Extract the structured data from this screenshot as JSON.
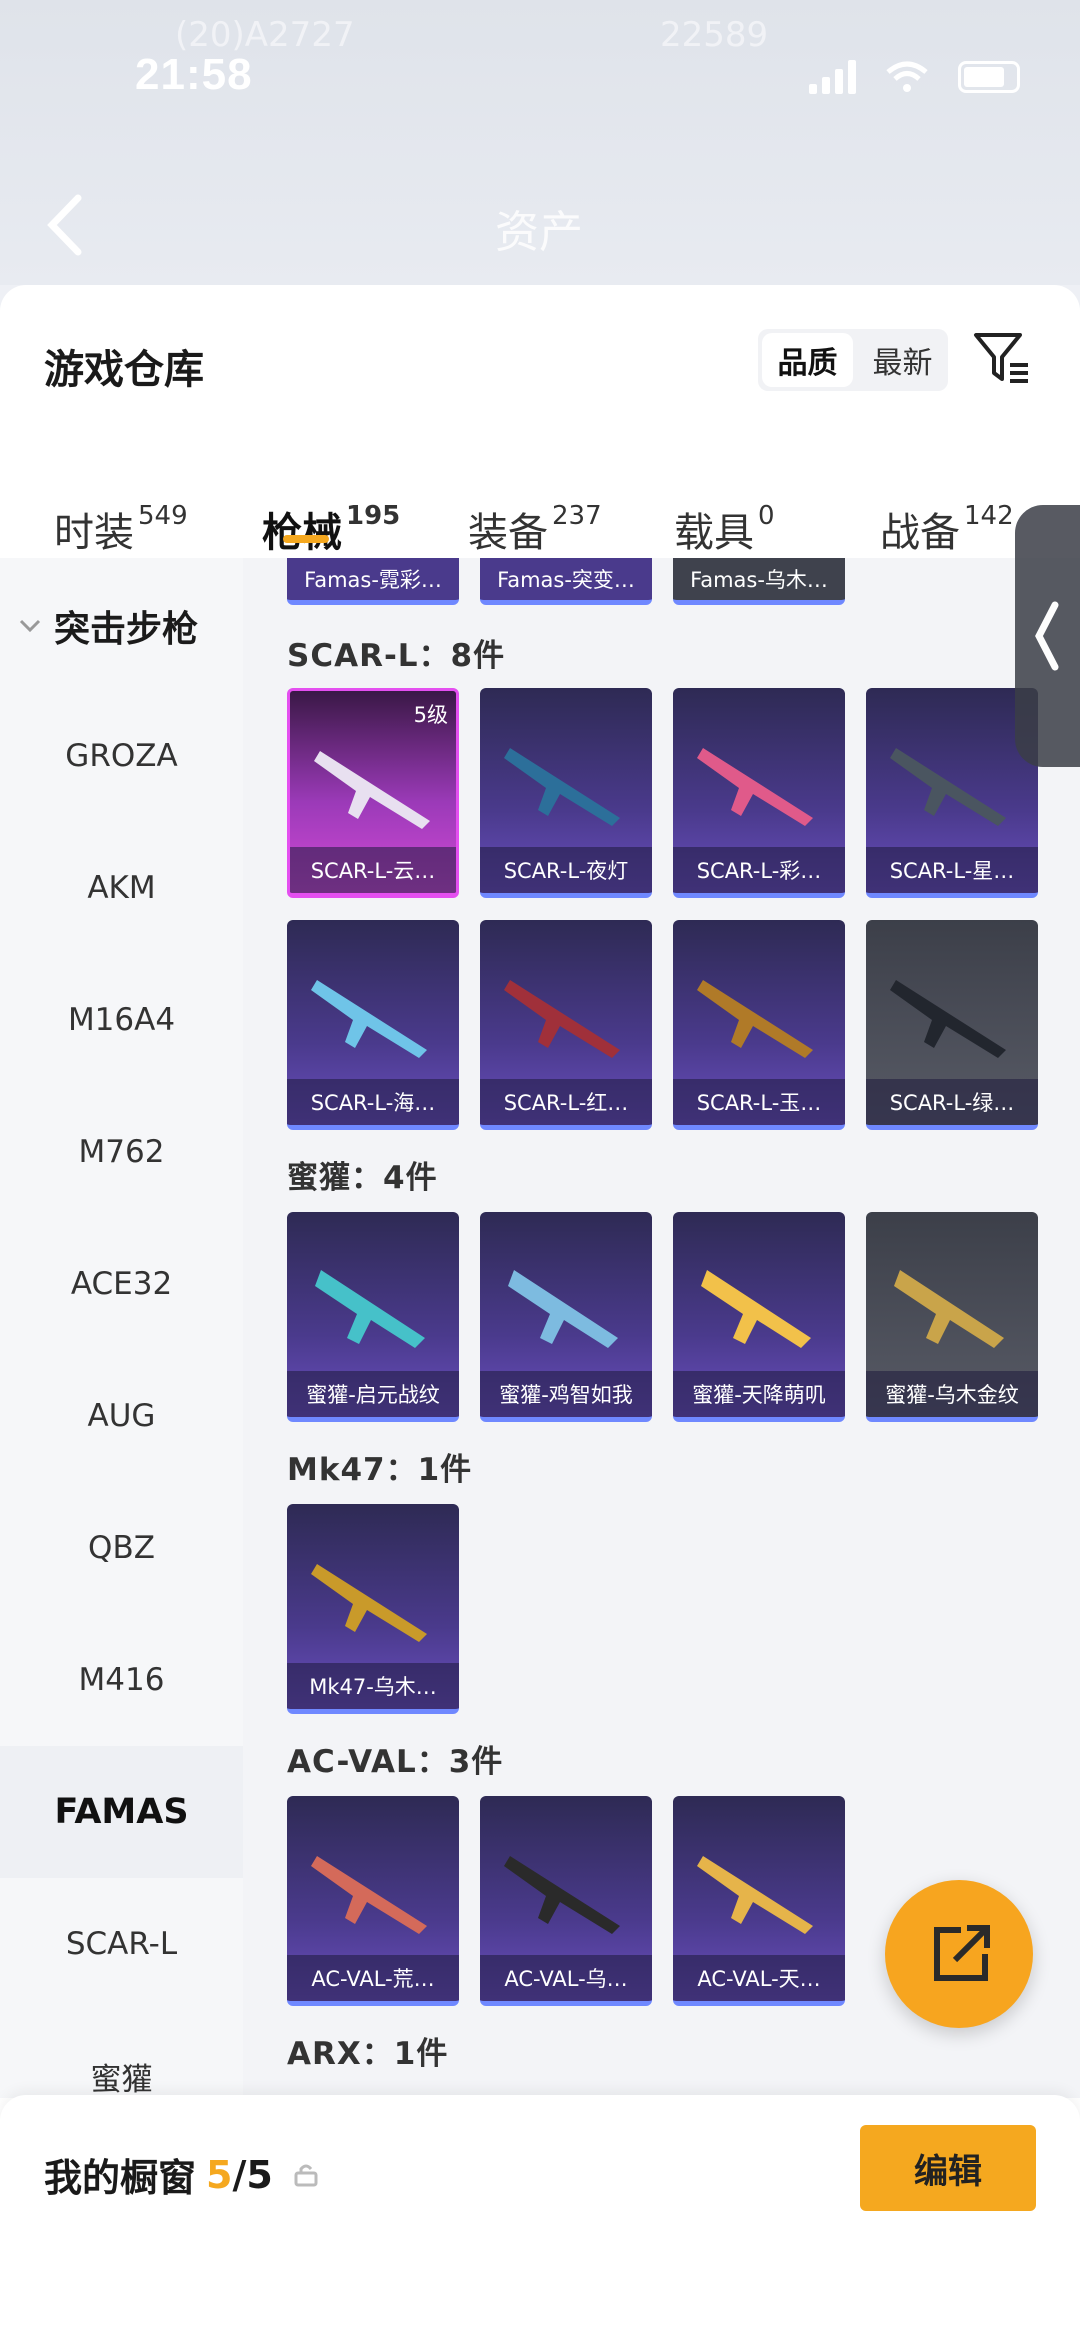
{
  "status": {
    "time": "21:58",
    "ghost_left": "(20)A2727",
    "ghost_right": "22589"
  },
  "nav": {
    "title": "资产"
  },
  "sheet": {
    "title": "游戏仓库",
    "sort": {
      "options": [
        "品质",
        "最新"
      ],
      "selected": "品质"
    }
  },
  "tabs": [
    {
      "label": "时装",
      "count": "549"
    },
    {
      "label": "枪械",
      "count": "195",
      "active": true
    },
    {
      "label": "装备",
      "count": "237"
    },
    {
      "label": "载具",
      "count": "0"
    },
    {
      "label": "战备",
      "count": "142"
    }
  ],
  "sidebar": {
    "category": "突击步枪",
    "items": [
      "GROZA",
      "AKM",
      "M16A4",
      "M762",
      "ACE32",
      "AUG",
      "QBZ",
      "M416",
      "FAMAS",
      "SCAR-L",
      "蜜獾"
    ],
    "selected": "FAMAS"
  },
  "partial_row": [
    "Famas-霓彩…",
    "Famas-突变…",
    "Famas-乌木…"
  ],
  "sections": [
    {
      "title": "SCAR-L：8件",
      "items": [
        {
          "name": "SCAR-L-云…",
          "level": "5级"
        },
        {
          "name": "SCAR-L-夜灯"
        },
        {
          "name": "SCAR-L-彩…"
        },
        {
          "name": "SCAR-L-星…"
        },
        {
          "name": "SCAR-L-海…"
        },
        {
          "name": "SCAR-L-红…"
        },
        {
          "name": "SCAR-L-玉…"
        },
        {
          "name": "SCAR-L-绿…"
        }
      ]
    },
    {
      "title": "蜜獾：4件",
      "items": [
        {
          "name": "蜜獾-启元战纹"
        },
        {
          "name": "蜜獾-鸡智如我"
        },
        {
          "name": "蜜獾-天降萌叽"
        },
        {
          "name": "蜜獾-乌木金纹"
        }
      ]
    },
    {
      "title": "Mk47：1件",
      "items": [
        {
          "name": "Mk47-乌木…"
        }
      ]
    },
    {
      "title": "AC-VAL：3件",
      "items": [
        {
          "name": "AC-VAL-荒…"
        },
        {
          "name": "AC-VAL-乌…"
        },
        {
          "name": "AC-VAL-天…"
        }
      ]
    },
    {
      "title": "ARX：1件",
      "items": []
    }
  ],
  "bottom": {
    "title": "我的橱窗",
    "count": "5",
    "total": "/5",
    "edit_label": "编辑"
  },
  "colors": {
    "accent": "#f5a81f",
    "card_purple": "#4a3a8c",
    "card_border": "#6f88ff"
  }
}
